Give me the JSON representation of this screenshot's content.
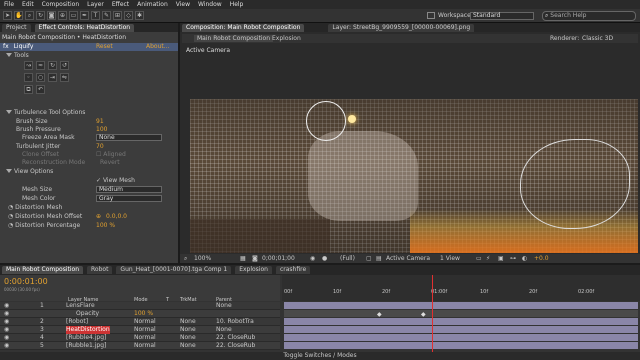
{
  "menu": [
    "File",
    "Edit",
    "Composition",
    "Layer",
    "Effect",
    "Animation",
    "View",
    "Window",
    "Help"
  ],
  "workspace": {
    "label": "Workspace:",
    "value": "Standard"
  },
  "search": {
    "placeholder": "Search Help"
  },
  "left_tabs": [
    "Project",
    "Effect Controls: HeatDistortion"
  ],
  "breadcrumb": "Main Robot Composition • HeatDistortion",
  "effect": {
    "name": "Liquify",
    "reset": "Reset",
    "about": "About..."
  },
  "tools_label": "Tools",
  "turbulence": {
    "header": "Turbulence Tool Options",
    "brush_size_label": "Brush Size",
    "brush_size": "91",
    "brush_pressure_label": "Brush Pressure",
    "brush_pressure": "100",
    "freeze_label": "Freeze Area Mask",
    "freeze_value": "None",
    "jitter_label": "Turbulent Jitter",
    "jitter": "70",
    "clone_offset_label": "Clone Offset",
    "aligned_label": "Aligned",
    "reconstruction_label": "Reconstruction Mode",
    "reconstruction_value": "Revert"
  },
  "view_options": {
    "header": "View Options",
    "view_mesh_label": "View Mesh",
    "mesh_size_label": "Mesh Size",
    "mesh_size": "Medium",
    "mesh_color_label": "Mesh Color",
    "mesh_color": "Gray"
  },
  "distortion": {
    "mesh_label": "Distortion Mesh",
    "offset_label": "Distortion Mesh Offset",
    "offset": "0.0,0.0",
    "percentage_label": "Distortion Percentage",
    "percentage": "100 %"
  },
  "comp_tabs": {
    "title": "Composition: Main Robot Composition",
    "layer": "Layer: StreetBg_9909559_[00000-00069].png",
    "sub1": "Main Robot Composition",
    "sub2": "Explosion",
    "renderer_label": "Renderer:",
    "renderer": "Classic 3D"
  },
  "viewer": {
    "camera_label": "Active Camera",
    "zoom": "100%",
    "timecode": "0;00;01;00",
    "quality": "(Full)",
    "camera": "Active Camera",
    "views": "1 View",
    "exposure": "+0.0"
  },
  "timeline_tabs": [
    "Main Robot Composition",
    "Robot",
    "Gun_Heat_[0001-0070].tga Comp 1",
    "Explosion",
    "crashfire"
  ],
  "timeline": {
    "timecode": "0:00:01:00",
    "fps": "00030 (30.00 fps)",
    "headers": {
      "layer_name": "Layer Name",
      "mode": "Mode",
      "t": "T",
      "trkmat": "TrkMat",
      "parent": "Parent"
    },
    "ruler": [
      "00f",
      "10f",
      "20f",
      "01:00f",
      "10f",
      "20f",
      "02:00f"
    ],
    "footer": "Toggle Switches / Modes"
  },
  "layers": [
    {
      "num": "1",
      "name": "LensFlare",
      "mode": "",
      "trkmat": "",
      "parent": "None"
    },
    {
      "num": "",
      "name": "Opacity",
      "mode": "100 %",
      "trkmat": "",
      "parent": ""
    },
    {
      "num": "2",
      "name": "[Robot]",
      "mode": "Normal",
      "trkmat": "None",
      "parent": "10. RobotTra"
    },
    {
      "num": "3",
      "name": "HeatDistortion",
      "mode": "Normal",
      "trkmat": "None",
      "parent": "None"
    },
    {
      "num": "4",
      "name": "[Rubble4.jpg]",
      "mode": "Normal",
      "trkmat": "None",
      "parent": "22. CloseRub"
    },
    {
      "num": "5",
      "name": "[Rubble1.jpg]",
      "mode": "Normal",
      "trkmat": "None",
      "parent": "22. CloseRub"
    }
  ],
  "colors": {
    "accent": "#e0a030",
    "playhead": "#e03030",
    "layer_bar": "#8a86a8"
  }
}
